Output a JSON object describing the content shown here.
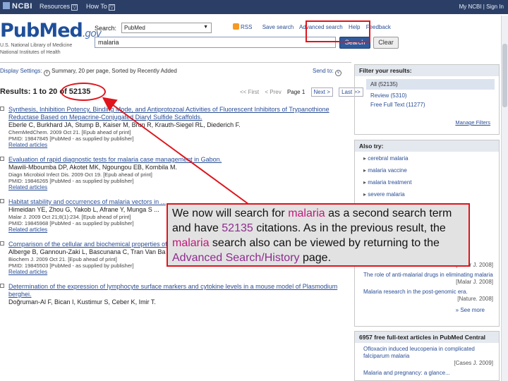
{
  "topbar": {
    "logo": "NCBI",
    "menu_resources": "Resources",
    "menu_howto": "How To",
    "caret": "▽",
    "account": "My NCBI | Sign In"
  },
  "header": {
    "logo_main": "PubMed",
    "logo_gov": ".gov",
    "sub_line1": "U.S. National Library of Medicine",
    "sub_line2": "National Institutes of Health",
    "search_label": "Search:",
    "database": "PubMed",
    "links": {
      "rss": "RSS",
      "save_search": "Save search",
      "advanced_search": "Advanced search",
      "help": "Help",
      "feedback": "Feedback"
    },
    "query": "malaria",
    "search_button": "Search",
    "clear_button": "Clear"
  },
  "display": {
    "settings": "Display Settings:",
    "summary": "Summary, 20 per page, Sorted by Recently Added",
    "send_to": "Send to:"
  },
  "results_count": {
    "prefix": "Results: 1 to 20 of ",
    "total": "52135"
  },
  "pager": {
    "first": "<< First",
    "prev": "< Prev",
    "page": "Page 1",
    "next": "Next >",
    "last": "Last >>"
  },
  "results": [
    {
      "title": "Synthesis, Inhibition Potency, Binding Mode, and Antiprotozoal Activities of Fluorescent Inhibitors of Trypanothione Reductase Based on Mepacrine-Conjugated Diaryl Sulfide Scaffolds.",
      "authors": "Eberle C, Burkhard JA, Stump B, Kaiser M, Brun R, Krauth-Siegel RL, Diederich F.",
      "meta1": "ChemMedChem. 2009 Oct 21. [Epub ahead of print]",
      "meta2": "PMID: 19847845 [PubMed - as supplied by publisher]",
      "related": "Related articles"
    },
    {
      "title": "Evaluation of rapid diagnostic tests for malaria case management in Gabon.",
      "authors": "Mawili-Mboumba DP, Akotet MK, Ngoungou EB, Kombila M.",
      "meta1": "Diagn Microbiol Infect Dis. 2009 Oct 19. [Epub ahead of print]",
      "meta2": "PMID: 19846265 [PubMed - as supplied by publisher]",
      "related": "Related articles"
    },
    {
      "title": "Habitat stability and occurrences of malaria vectors in ...",
      "authors": "Himeidan YE, Zhou G, Yakob L, Afrane Y, Munga S ...",
      "meta1": "Malar J. 2009 Oct 21;8(1):234. [Epub ahead of print]",
      "meta2": "PMID: 19845968 [PubMed - as supplied by publisher]",
      "related": "Related articles"
    },
    {
      "title": "Comparison of the cellular and biochemical properties of Plasmodium falciparum choline and ethanolamine kinases.",
      "authors": "Alberge B, Gannoun-Zaki L, Bascunana C, Tran Van Ba C, Vial H, Cerdan R.",
      "meta1": "Biochem J. 2009 Oct 21. [Epub ahead of print]",
      "meta2": "PMID: 19845503 [PubMed - as supplied by publisher]",
      "related": "Related articles"
    },
    {
      "title": "Determination of the expression of lymphocyte surface markers and cytokine levels in a mouse model of Plasmodium berghei.",
      "authors": "Doğruman-Al F, Bican I, Kustimur S, Ceber K, Imir T.",
      "meta1": "",
      "meta2": "",
      "related": ""
    }
  ],
  "filters": {
    "header": "Filter your results:",
    "items": [
      "All (52135)",
      "Review (5310)",
      "Free Full Text (11277)"
    ],
    "manage": "Manage Filters"
  },
  "also_try": {
    "header": "Also try:",
    "items": [
      "cerebral malaria",
      "malaria vaccine",
      "malaria treatment",
      "severe malaria"
    ]
  },
  "related_items": [
    {
      "text": "The role of anti-malarial drugs in eliminating malaria",
      "src": "[Malar J. 2008]"
    },
    {
      "text": "Malaria research in the post-genomic era.",
      "src": "[Nature. 2008]"
    }
  ],
  "rel_source_top": "[Malar J. 2008]",
  "see_more": "» See more",
  "pmc": {
    "header": "6957 free full-text articles in PubMed Central",
    "item_text": "Ofloxacin induced leucopenia in complicated falciparum malaria",
    "item_src": "[Cases J. 2009]",
    "item2": "Malaria and pregnancy: a glance..."
  },
  "callout": {
    "p1": "We now will search for ",
    "w1": "malaria",
    "p2": " as a second search term and have ",
    "w2": "52135",
    "p3": " citations.  As in the previous result, the ",
    "w3": "malaria",
    "p4": " search also can be viewed by returning to the ",
    "w4": "Advanced Search/History",
    "p5": " page."
  },
  "colors": {
    "highlight_red": "#e0141c",
    "magenta": "#c2187a",
    "purple": "#8e2c8e",
    "link_blue": "#2a4e95"
  }
}
